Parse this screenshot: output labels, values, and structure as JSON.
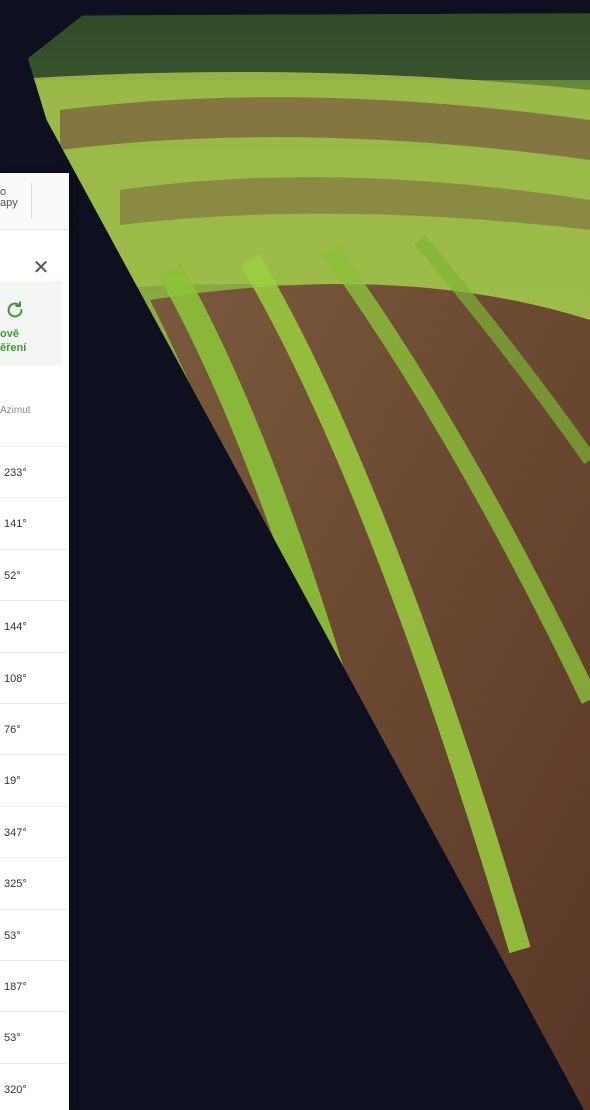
{
  "toolbar": {
    "map_label": "o\napy"
  },
  "panel": {
    "close_glyph": "✕",
    "refresh_label": "ově\něření",
    "column_header": "Azimut",
    "azimuths": [
      "233°",
      "141°",
      "52°",
      "144°",
      "108°",
      "76°",
      "19°",
      "347°",
      "325°",
      "53°",
      "187°",
      "53°",
      "320°"
    ]
  },
  "colors": {
    "background": "#0e0f1f",
    "accent_green": "#3a9d2f",
    "panel_bg": "#ffffff"
  }
}
